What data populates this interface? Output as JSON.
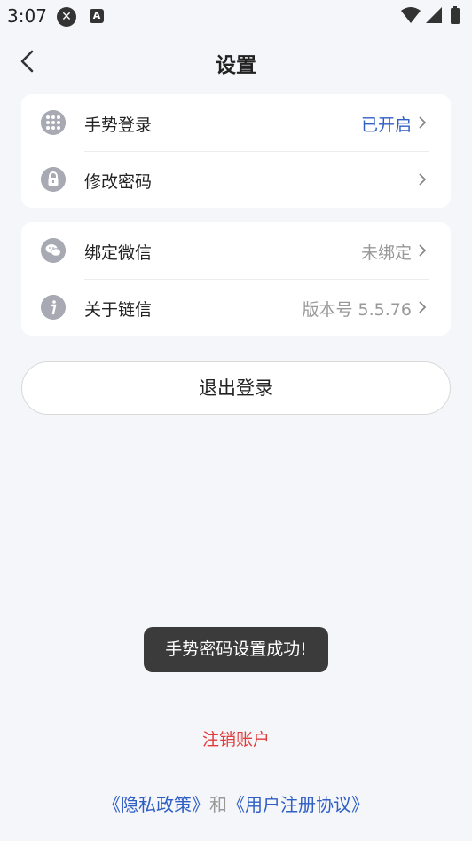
{
  "status_bar": {
    "time": "3:07",
    "a_icon": "A",
    "icons": [
      "close-circle-icon",
      "a-icon",
      "wifi-icon",
      "signal-icon",
      "battery-icon"
    ]
  },
  "header": {
    "title": "设置"
  },
  "group1": [
    {
      "label": "手势登录",
      "value": "已开启",
      "icon": "grid-dots-icon"
    },
    {
      "label": "修改密码",
      "value": "",
      "icon": "lock-icon"
    }
  ],
  "group2": [
    {
      "label": "绑定微信",
      "value": "未绑定",
      "icon": "wechat-icon"
    },
    {
      "label": "关于链信",
      "value": "版本号 5.5.76",
      "icon": "info-icon"
    }
  ],
  "logout_label": "退出登录",
  "toast": "手势密码设置成功!",
  "cancel_account": "注销账户",
  "footer": {
    "privacy": "《隐私政策》",
    "and": "和",
    "agreement": "《用户注册协议》"
  },
  "colors": {
    "accent": "#2f5ec4",
    "danger": "#e23b3b",
    "background": "#f4f6f9"
  }
}
